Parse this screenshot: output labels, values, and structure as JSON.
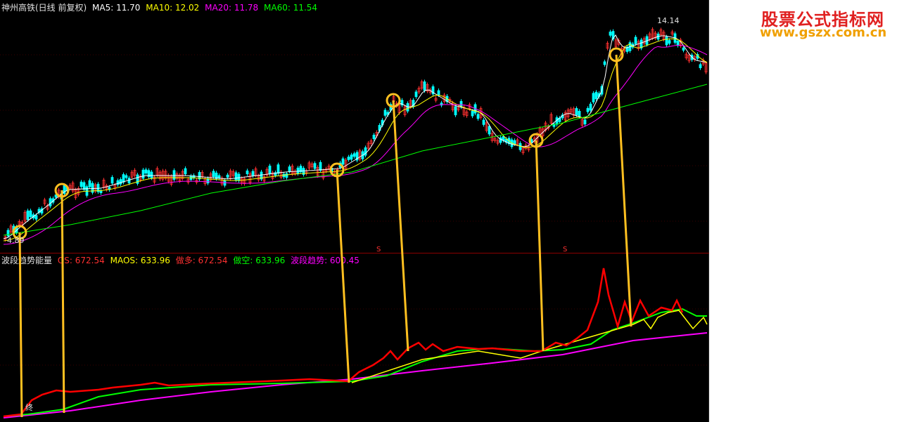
{
  "main_header": {
    "title": "神州高铁(日线 前复权)",
    "ma5": "MA5: 11.70",
    "ma10": "MA10: 12.02",
    "ma20": "MA20: 11.78",
    "ma60": "MA60: 11.54"
  },
  "indicator_header": {
    "name": "波段趋势能量",
    "os": "OS: 672.54",
    "maos": "MAOS: 633.96",
    "long": "做多: 672.54",
    "short": "做空: 633.96",
    "trend": "波段趋势: 600.45"
  },
  "annotations": {
    "high_price": "14.14",
    "low_price": "4.89",
    "end_marker": "终",
    "s_marker": "S"
  },
  "watermark": {
    "line1": "股票公式指标网",
    "line2": "www.gszx.com.cn"
  },
  "colors": {
    "ma5": "#ffffff",
    "ma10": "#ffff00",
    "ma20": "#ff00ff",
    "ma60": "#00ff00",
    "candle_up": "#ff3030",
    "candle_down": "#00ffff",
    "os_line": "#ff0000",
    "maos_line": "#ffff00",
    "long_line": "#ff0000",
    "short_line": "#00ff00",
    "trend_line": "#ff00ff",
    "connector": "#ffc020"
  }
}
